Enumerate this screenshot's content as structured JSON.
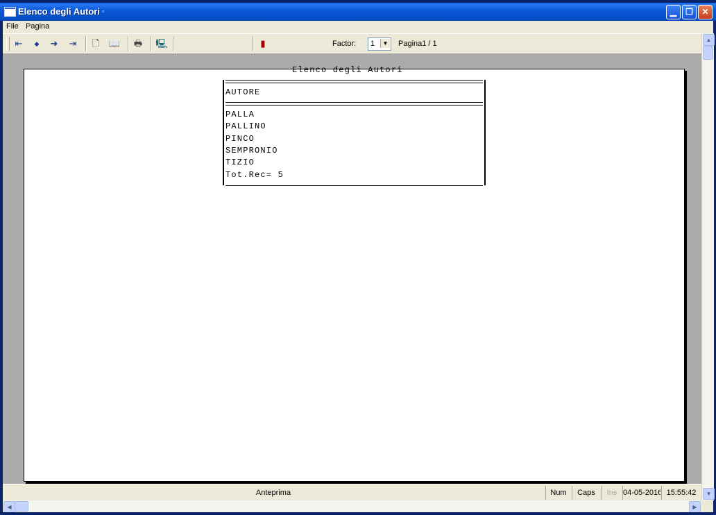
{
  "window": {
    "title": "Elenco degli Autori",
    "minimize_glyph": "▁",
    "restore_glyph": "❐",
    "close_glyph": "✕"
  },
  "menu": {
    "file": "File",
    "pagina": "Pagina"
  },
  "toolbar": {
    "icons": [
      "first-page-icon",
      "prev-page-icon",
      "next-page-icon",
      "last-page-icon",
      "single-page-icon",
      "two-pages-icon",
      "print-icon",
      "export-icon",
      "exit-door-icon"
    ],
    "glyphs": {
      "first": "⇤",
      "prev": "◆",
      "next": "➜",
      "last": "⇥",
      "single": "🗋",
      "two": "📖",
      "print": "🖶",
      "export": "🖳",
      "exit": "▮"
    },
    "factor_label": "Factor:",
    "factor_value": "1",
    "page_info": "Pagina1 / 1"
  },
  "report": {
    "title": "Elenco degli Autori",
    "column_header": "AUTORE",
    "rows": [
      "PALLA",
      "PALLINO",
      "PINCO",
      "SEMPRONIO",
      "TIZIO"
    ],
    "total": "Tot.Rec= 5"
  },
  "status": {
    "mode": "Anteprima",
    "num": "Num",
    "caps": "Caps",
    "ins": "Ins",
    "date": "04-05-2016",
    "time": "15:55:42"
  },
  "colors": {
    "title_bar": "#0a5ce6",
    "chrome": "#ece9d8",
    "preview_bg": "#ababab",
    "disabled_text": "#aca899"
  }
}
